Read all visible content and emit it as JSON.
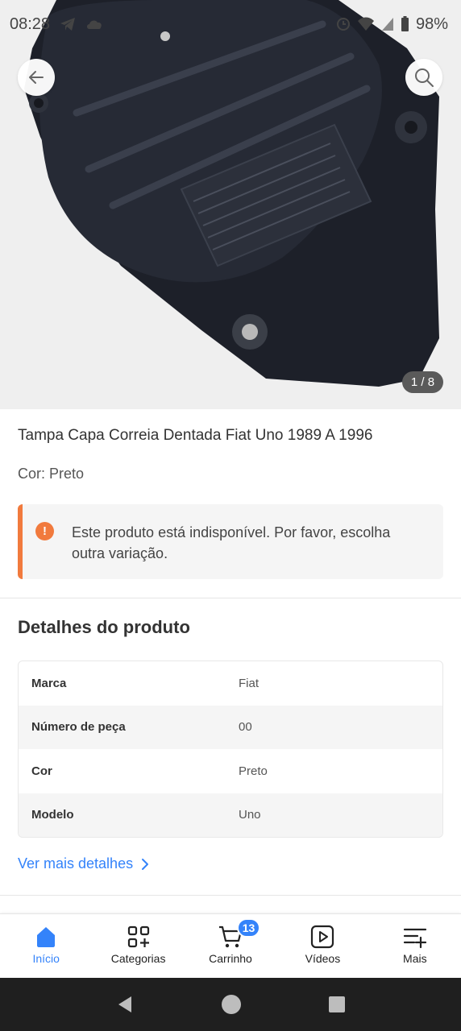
{
  "status_bar": {
    "time": "08:28",
    "battery": "98%"
  },
  "gallery": {
    "counter": "1 / 8"
  },
  "product": {
    "title": "Tampa Capa Correia Dentada Fiat Uno 1989 A 1996",
    "color_line": "Cor: Preto"
  },
  "alert": {
    "message": "Este produto está indisponível. Por favor, escolha outra variação.",
    "color": "#f17a3d"
  },
  "details": {
    "title": "Detalhes do produto",
    "rows": [
      {
        "key": "Marca",
        "value": "Fiat"
      },
      {
        "key": "Número de peça",
        "value": "00"
      },
      {
        "key": "Cor",
        "value": "Preto"
      },
      {
        "key": "Modelo",
        "value": "Uno"
      }
    ],
    "more_link": "Ver mais detalhes"
  },
  "nav": {
    "items": [
      {
        "label": "Início",
        "icon": "home-icon",
        "active": true
      },
      {
        "label": "Categorias",
        "icon": "categories-icon"
      },
      {
        "label": "Carrinho",
        "icon": "cart-icon",
        "badge": "13"
      },
      {
        "label": "Vídeos",
        "icon": "video-icon"
      },
      {
        "label": "Mais",
        "icon": "more-icon"
      }
    ]
  },
  "colors": {
    "accent": "#3483fa",
    "warning": "#f17a3d"
  }
}
